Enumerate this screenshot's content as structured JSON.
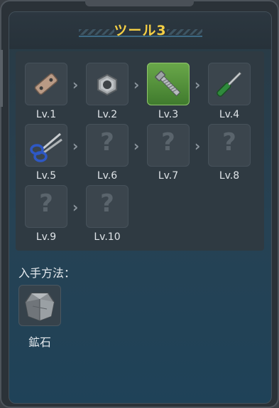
{
  "title": "ツール3",
  "tools": [
    {
      "level": "Lv.1",
      "icon": "metal-plate-icon",
      "unlocked": true,
      "selected": false
    },
    {
      "level": "Lv.2",
      "icon": "hex-nut-icon",
      "unlocked": true,
      "selected": false
    },
    {
      "level": "Lv.3",
      "icon": "bolt-icon",
      "unlocked": true,
      "selected": true
    },
    {
      "level": "Lv.4",
      "icon": "screwdriver-icon",
      "unlocked": true,
      "selected": false
    },
    {
      "level": "Lv.5",
      "icon": "scissors-icon",
      "unlocked": true,
      "selected": false
    },
    {
      "level": "Lv.6",
      "icon": "unknown-icon",
      "unlocked": false,
      "selected": false
    },
    {
      "level": "Lv.7",
      "icon": "unknown-icon",
      "unlocked": false,
      "selected": false
    },
    {
      "level": "Lv.8",
      "icon": "unknown-icon",
      "unlocked": false,
      "selected": false
    },
    {
      "level": "Lv.9",
      "icon": "unknown-icon",
      "unlocked": false,
      "selected": false
    },
    {
      "level": "Lv.10",
      "icon": "unknown-icon",
      "unlocked": false,
      "selected": false
    }
  ],
  "locked_symbol": "?",
  "acquisition": {
    "label": "入手方法：",
    "sources": [
      {
        "name": "鉱石",
        "icon": "ore-icon"
      }
    ]
  },
  "colors": {
    "title": "#f4cf45",
    "selected": "#5d9e43"
  }
}
